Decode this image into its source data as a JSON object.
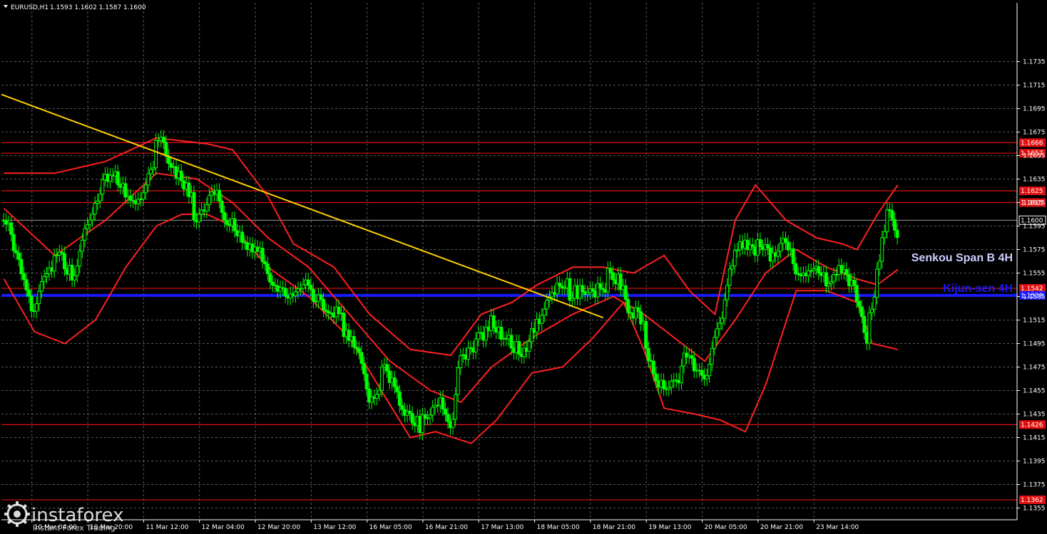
{
  "header": {
    "symbol": "EURUSD,H1",
    "ohlc": "1.1593 1.1602 1.1587 1.1600"
  },
  "logo": {
    "name": "instaforex",
    "tagline": "Instant Forex Trading"
  },
  "labels": {
    "senkou": "Senkou Span B 4H",
    "kijun": "Kijun-sen 4H"
  },
  "colors": {
    "background": "#000000",
    "grid": "#808080",
    "candles": "#00ff00",
    "bands": "#ff2020",
    "levels": "#e01010",
    "trendline": "#ffd000",
    "kijun": "#1a1aff",
    "senkou": "#ccccff",
    "current_price": "#ffffff"
  },
  "chart_data": {
    "type": "candlestick",
    "symbol": "EURUSD",
    "timeframe": "H1",
    "ylim": [
      1.1345,
      1.1785
    ],
    "y_ticks": [
      "1.1735",
      "1.1715",
      "1.1695",
      "1.1675",
      "1.1655",
      "1.1635",
      "1.1615",
      "1.1595",
      "1.1575",
      "1.1555",
      "1.1535",
      "1.1515",
      "1.1495",
      "1.1475",
      "1.1455",
      "1.1435",
      "1.1415",
      "1.1395",
      "1.1375",
      "1.1355"
    ],
    "x_ticks": [
      "10 Mar 04:00",
      "10 Mar 20:00",
      "11 Mar 12:00",
      "12 Mar 04:00",
      "12 Mar 20:00",
      "13 Mar 12:00",
      "16 Mar 05:00",
      "16 Mar 21:00",
      "17 Mar 13:00",
      "18 Mar 05:00",
      "18 Mar 21:00",
      "19 Mar 13:00",
      "20 Mar 05:00",
      "20 Mar 21:00",
      "23 Mar 14:00"
    ],
    "current_price": "1.1600",
    "horizontal_levels": [
      {
        "label": "1.1666",
        "value": 1.1666
      },
      {
        "label": "1.1657",
        "value": 1.1657
      },
      {
        "label": "1.1625",
        "value": 1.1625
      },
      {
        "label": "1.1615",
        "value": 1.1615
      },
      {
        "label": "1.1542",
        "value": 1.1542
      },
      {
        "label": "1.1426",
        "value": 1.1426
      },
      {
        "label": "1.1362",
        "value": 1.1362
      }
    ],
    "kijun_sen_4h": {
      "label": "1.1538",
      "value": 1.1536
    },
    "trendline": {
      "points": [
        [
          0,
          1.1707
        ],
        [
          118,
          1.1517
        ]
      ]
    },
    "close_path": [
      [
        0,
        1.16
      ],
      [
        3,
        1.156
      ],
      [
        6,
        1.1515
      ],
      [
        8,
        1.156
      ],
      [
        11,
        1.1575
      ],
      [
        14,
        1.1555
      ],
      [
        17,
        1.1595
      ],
      [
        20,
        1.163
      ],
      [
        23,
        1.1635
      ],
      [
        26,
        1.162
      ],
      [
        29,
        1.165
      ],
      [
        31,
        1.1662
      ],
      [
        33,
        1.164
      ],
      [
        36,
        1.162
      ],
      [
        38,
        1.1605
      ],
      [
        40,
        1.1618
      ],
      [
        42,
        1.1632
      ],
      [
        44,
        1.16
      ],
      [
        47,
        1.1575
      ],
      [
        50,
        1.157
      ],
      [
        53,
        1.155
      ],
      [
        56,
        1.154
      ],
      [
        59,
        1.1555
      ],
      [
        61,
        1.153
      ],
      [
        64,
        1.152
      ],
      [
        67,
        1.151
      ],
      [
        70,
        1.1495
      ],
      [
        72,
        1.1455
      ],
      [
        75,
        1.147
      ],
      [
        78,
        1.144
      ],
      [
        81,
        1.142
      ],
      [
        83,
        1.144
      ],
      [
        86,
        1.1455
      ],
      [
        88,
        1.143
      ],
      [
        90,
        1.1475
      ],
      [
        92,
        1.1485
      ],
      [
        95,
        1.15
      ],
      [
        97,
        1.1515
      ],
      [
        100,
        1.15
      ],
      [
        102,
        1.1495
      ],
      [
        105,
        1.1505
      ],
      [
        107,
        1.1525
      ],
      [
        110,
        1.154
      ],
      [
        112,
        1.1545
      ],
      [
        115,
        1.1545
      ],
      [
        118,
        1.1548
      ],
      [
        121,
        1.1545
      ],
      [
        123,
        1.152
      ],
      [
        126,
        1.151
      ],
      [
        128,
        1.147
      ],
      [
        131,
        1.146
      ],
      [
        134,
        1.148
      ],
      [
        136,
        1.147
      ],
      [
        138,
        1.1455
      ],
      [
        140,
        1.1495
      ],
      [
        142,
        1.1535
      ],
      [
        144,
        1.1585
      ],
      [
        146,
        1.1585
      ],
      [
        148,
        1.1575
      ],
      [
        151,
        1.1565
      ],
      [
        154,
        1.1575
      ],
      [
        156,
        1.1555
      ],
      [
        159,
        1.1565
      ],
      [
        162,
        1.1555
      ],
      [
        165,
        1.155
      ],
      [
        167,
        1.154
      ],
      [
        169,
        1.151
      ],
      [
        170,
        1.1495
      ],
      [
        172,
        1.156
      ],
      [
        174,
        1.1615
      ],
      [
        176,
        1.1595
      ]
    ],
    "indicators": {
      "bollinger_upper": [
        [
          0,
          1.164
        ],
        [
          10,
          1.164
        ],
        [
          20,
          1.165
        ],
        [
          25,
          1.166
        ],
        [
          30,
          1.167
        ],
        [
          40,
          1.1665
        ],
        [
          45,
          1.166
        ],
        [
          52,
          1.162
        ],
        [
          57,
          1.158
        ],
        [
          65,
          1.156
        ],
        [
          72,
          1.152
        ],
        [
          80,
          1.149
        ],
        [
          88,
          1.1485
        ],
        [
          94,
          1.152
        ],
        [
          100,
          1.153
        ],
        [
          105,
          1.1545
        ],
        [
          112,
          1.156
        ],
        [
          118,
          1.156
        ],
        [
          124,
          1.1555
        ],
        [
          130,
          1.157
        ],
        [
          135,
          1.154
        ],
        [
          140,
          1.152
        ],
        [
          144,
          1.16
        ],
        [
          148,
          1.163
        ],
        [
          154,
          1.16
        ],
        [
          160,
          1.1585
        ],
        [
          165,
          1.158
        ],
        [
          168,
          1.1575
        ],
        [
          172,
          1.1605
        ],
        [
          176,
          1.163
        ]
      ],
      "bollinger_lower": [
        [
          0,
          1.155
        ],
        [
          6,
          1.1505
        ],
        [
          12,
          1.1495
        ],
        [
          18,
          1.1515
        ],
        [
          24,
          1.156
        ],
        [
          30,
          1.1595
        ],
        [
          35,
          1.1605
        ],
        [
          40,
          1.1605
        ],
        [
          45,
          1.1595
        ],
        [
          52,
          1.156
        ],
        [
          60,
          1.1535
        ],
        [
          68,
          1.15
        ],
        [
          75,
          1.145
        ],
        [
          80,
          1.1415
        ],
        [
          85,
          1.142
        ],
        [
          92,
          1.141
        ],
        [
          97,
          1.143
        ],
        [
          104,
          1.147
        ],
        [
          110,
          1.1475
        ],
        [
          116,
          1.15
        ],
        [
          122,
          1.153
        ],
        [
          126,
          1.149
        ],
        [
          130,
          1.144
        ],
        [
          136,
          1.1435
        ],
        [
          141,
          1.143
        ],
        [
          146,
          1.142
        ],
        [
          150,
          1.146
        ],
        [
          156,
          1.154
        ],
        [
          162,
          1.154
        ],
        [
          168,
          1.153
        ],
        [
          171,
          1.1495
        ],
        [
          176,
          1.149
        ]
      ],
      "bollinger_middle": [
        [
          0,
          1.161
        ],
        [
          10,
          1.157
        ],
        [
          20,
          1.16
        ],
        [
          30,
          1.164
        ],
        [
          38,
          1.1635
        ],
        [
          45,
          1.1615
        ],
        [
          52,
          1.1585
        ],
        [
          60,
          1.156
        ],
        [
          68,
          1.152
        ],
        [
          76,
          1.148
        ],
        [
          84,
          1.1455
        ],
        [
          90,
          1.1445
        ],
        [
          96,
          1.1475
        ],
        [
          104,
          1.15
        ],
        [
          112,
          1.152
        ],
        [
          120,
          1.1535
        ],
        [
          126,
          1.152
        ],
        [
          132,
          1.15
        ],
        [
          138,
          1.148
        ],
        [
          144,
          1.1515
        ],
        [
          150,
          1.1555
        ],
        [
          156,
          1.1575
        ],
        [
          162,
          1.156
        ],
        [
          168,
          1.155
        ],
        [
          172,
          1.1545
        ],
        [
          176,
          1.1558
        ]
      ]
    }
  }
}
